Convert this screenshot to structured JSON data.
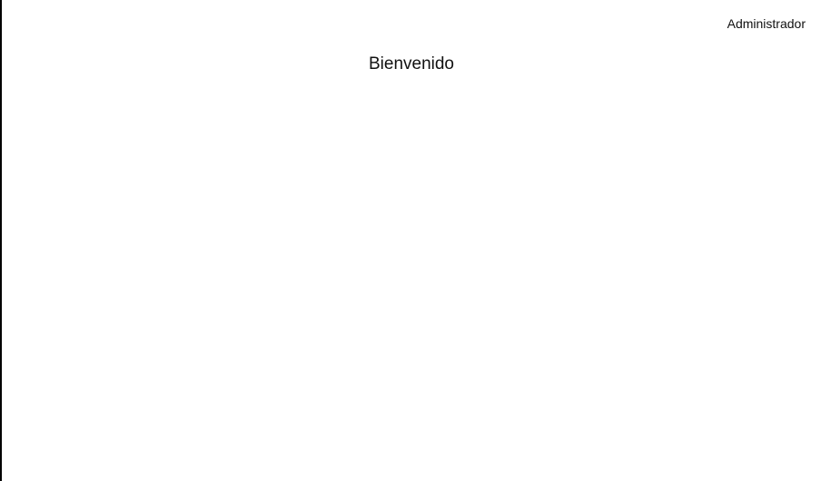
{
  "header": {
    "user_label": "Administrador"
  },
  "main": {
    "title": "Bienvenido"
  },
  "colors": {
    "background": "#ffffff",
    "text": "#111111",
    "left_rule": "#000000"
  }
}
